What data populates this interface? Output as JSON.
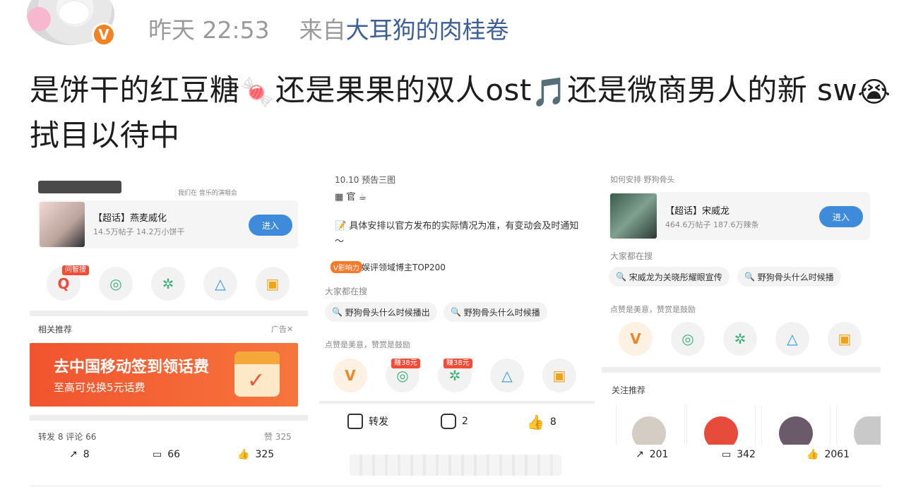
{
  "header": {
    "time": "昨天 22:53",
    "from_prefix": "来自",
    "source": "大耳狗的肉桂卷",
    "verified_badge": "V"
  },
  "post": {
    "seg1": "是饼干的红豆糖",
    "emoji1": "🍬",
    "seg2": "还是果果的双人ost",
    "emoji2": "🎵",
    "seg3": "还是微商男人的新 sw",
    "emoji3": "😭",
    "seg4": "拭目以待中"
  },
  "shot1": {
    "top_caption": "我们在 音乐的演唱会",
    "topic_title": "【超话】燕麦威化",
    "topic_stats": "14.5万帖子 14.2万小饼干",
    "enter": "进入",
    "badge": "问智搜",
    "related": "相关推荐",
    "ad_flag": "广告✕",
    "ad_title": "去中国移动签到领话费",
    "ad_sub": "至高可兑换5元话费",
    "tabs_text": "转发 8    评论 66",
    "likes_text": "赞 325",
    "repost_count": "8",
    "comment_count": "66",
    "like_count": "325"
  },
  "shot2": {
    "line_top": "10.10 预告三图",
    "line_official": "官",
    "body": "具体安排以官方发布的实际情况为准，有变动会及时通知～",
    "rank_tag": "V影响力",
    "rank_text": "娱评领域博主TOP200",
    "search_label": "大家都在搜",
    "chip1": "野狗骨头什么时候播出",
    "chip2": "野狗骨头什么时候播",
    "praise": "点赞是美意，赞赏是鼓励",
    "tag1": "赚38元",
    "tag2": "赚38元",
    "repost": "转发",
    "comments": "2",
    "likes": "8"
  },
  "shot3": {
    "top_caption": "如何安排 野狗骨头",
    "topic_title": "【超话】宋威龙",
    "topic_stats": "464.6万帖子 187.6万辣条",
    "enter": "进入",
    "search_label": "大家都在搜",
    "chip1": "宋威龙为关晓彤耀眼宣传",
    "chip2": "野狗骨头什么时候播",
    "praise": "点赞是美意，赞赏是鼓励",
    "follow": "关注推荐",
    "repost_count": "201",
    "comment_count": "342",
    "like_count": "2061"
  }
}
